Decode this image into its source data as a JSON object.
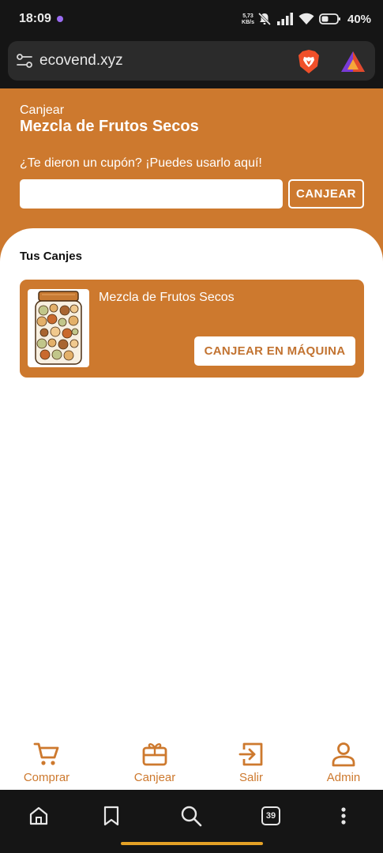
{
  "status_bar": {
    "time": "18:09",
    "speed_value": "5,73",
    "speed_unit": "KB/s",
    "battery": "40%",
    "icons": [
      "dot-indicator",
      "mute-icon",
      "signal-icon",
      "wifi-icon",
      "battery-icon"
    ]
  },
  "browser": {
    "url": "ecovend.xyz",
    "icons": [
      "site-settings-icon",
      "brave-shields-icon",
      "brave-rewards-icon"
    ],
    "toolbar": {
      "tab_count": "39",
      "icons": [
        "home-icon",
        "bookmark-icon",
        "search-icon",
        "tabs-icon",
        "more-icon"
      ]
    }
  },
  "page": {
    "subtitle": "Canjear",
    "title": "Mezcla de Frutos Secos",
    "coupon_prompt": "¿Te dieron un cupón? ¡Puedes usarlo aquí!",
    "coupon_input_value": "",
    "coupon_button": "CANJEAR",
    "section_heading": "Tus Canjes",
    "redemptions": [
      {
        "product_name": "Mezcla de Frutos Secos",
        "button_label": "CANJEAR EN MÁQUINA",
        "image_icon": "nut-jar-image"
      }
    ]
  },
  "bottom_nav": {
    "items": [
      {
        "label": "Comprar",
        "icon": "cart-icon"
      },
      {
        "label": "Canjear",
        "icon": "gift-card-icon"
      },
      {
        "label": "Salir",
        "icon": "logout-icon"
      },
      {
        "label": "Admin",
        "icon": "user-icon"
      }
    ]
  },
  "colors": {
    "brand_orange": "#cd792e",
    "status_bar_bg": "#151515",
    "url_bar_bg": "#2b2b2b",
    "white": "#ffffff",
    "home_indicator": "#e4a126"
  }
}
